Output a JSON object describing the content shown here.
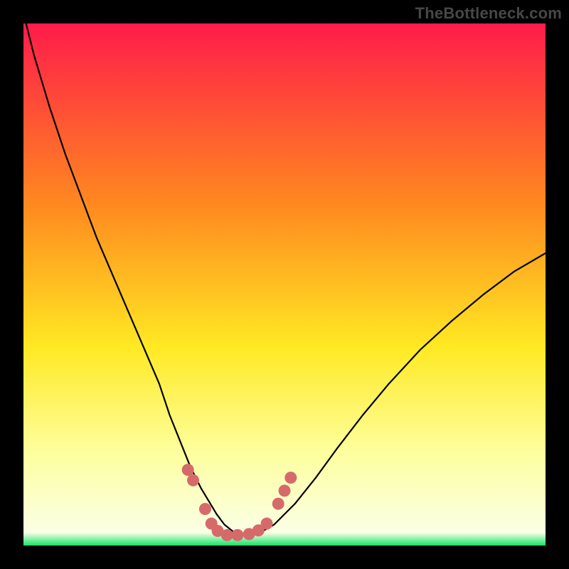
{
  "watermark": "TheBottleneck.com",
  "colors": {
    "frame_bg": "#000000",
    "gradient_top": "#ff1b4a",
    "gradient_mid1": "#ff8a1f",
    "gradient_mid2": "#ffe923",
    "gradient_low": "#fdff9d",
    "gradient_bottom": "#15e36a",
    "curve": "#000000",
    "dots": "#d66a6a"
  },
  "chart_data": {
    "type": "line",
    "title": "",
    "xlabel": "",
    "ylabel": "",
    "xlim": [
      0,
      100
    ],
    "ylim": [
      0,
      100
    ],
    "grid": false,
    "legend": "none",
    "series": [
      {
        "name": "bottleneck-curve",
        "x": [
          0.5,
          2,
          5,
          8,
          11,
          14,
          17,
          20,
          23,
          26,
          28,
          30,
          32,
          34,
          35.5,
          37,
          38.5,
          40,
          41.5,
          43,
          45,
          48,
          52,
          56,
          60,
          65,
          70,
          76,
          82,
          88,
          94,
          100
        ],
        "y": [
          100,
          94,
          84,
          75,
          67,
          59,
          52,
          45,
          38,
          31,
          25,
          20,
          15,
          11,
          8.5,
          6,
          4,
          2.8,
          2,
          2,
          2.3,
          4,
          8,
          13,
          18.5,
          25,
          31,
          37.5,
          43,
          48,
          52.5,
          56
        ]
      }
    ],
    "dots": [
      {
        "x": 31.5,
        "y": 14.5
      },
      {
        "x": 32.5,
        "y": 12.5
      },
      {
        "x": 34.8,
        "y": 7.0
      },
      {
        "x": 36.0,
        "y": 4.2
      },
      {
        "x": 37.2,
        "y": 2.8
      },
      {
        "x": 39.0,
        "y": 2.0
      },
      {
        "x": 41.0,
        "y": 2.0
      },
      {
        "x": 43.2,
        "y": 2.2
      },
      {
        "x": 45.0,
        "y": 2.9
      },
      {
        "x": 46.6,
        "y": 4.2
      },
      {
        "x": 48.8,
        "y": 8.0
      },
      {
        "x": 50.0,
        "y": 10.5
      },
      {
        "x": 51.2,
        "y": 13.0
      }
    ]
  }
}
